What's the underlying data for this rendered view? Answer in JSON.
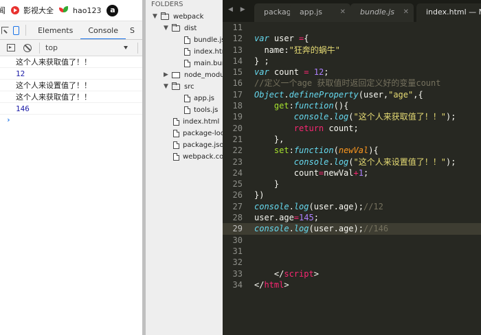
{
  "bookmarks": {
    "items": [
      {
        "label": "闻"
      },
      {
        "label": "影视大全"
      },
      {
        "label": "hao123"
      },
      {
        "label": ""
      }
    ]
  },
  "devtools": {
    "tabs": [
      "Elements",
      "Console",
      "S"
    ],
    "active_tab": "Console",
    "context": "top",
    "console_lines": [
      {
        "text": "这个人来获取值了！！",
        "kind": "txt"
      },
      {
        "text": "12",
        "kind": "num"
      },
      {
        "text": "这个人来设置值了！！",
        "kind": "txt"
      },
      {
        "text": "这个人来获取值了！！",
        "kind": "txt"
      },
      {
        "text": "146",
        "kind": "num"
      }
    ],
    "prompt": "›"
  },
  "sidebar": {
    "header": "FOLDERS",
    "tree": [
      {
        "label": "webpack",
        "type": "folder-open",
        "depth": 0
      },
      {
        "label": "dist",
        "type": "folder-open",
        "depth": 1
      },
      {
        "label": "bundle.js",
        "type": "file",
        "depth": 2
      },
      {
        "label": "index.html",
        "type": "file",
        "depth": 2
      },
      {
        "label": "main.bundle.js",
        "type": "file",
        "depth": 2
      },
      {
        "label": "node_modules",
        "type": "folder-closed",
        "depth": 1
      },
      {
        "label": "src",
        "type": "folder-open",
        "depth": 1
      },
      {
        "label": "app.js",
        "type": "file",
        "depth": 2
      },
      {
        "label": "tools.js",
        "type": "file",
        "depth": 2
      },
      {
        "label": "index.html",
        "type": "file",
        "depth": 1
      },
      {
        "label": "package-lock.json",
        "type": "file",
        "depth": 1
      },
      {
        "label": "package.json",
        "type": "file",
        "depth": 1
      },
      {
        "label": "webpack.config.js",
        "type": "file",
        "depth": 1
      }
    ]
  },
  "editor": {
    "nav": "◀ ▶",
    "tabs": [
      {
        "label": "package.json",
        "active": false,
        "italic": false
      },
      {
        "label": "app.js",
        "active": false,
        "italic": false
      },
      {
        "label": "bundle.js",
        "active": false,
        "italic": true
      },
      {
        "label": "index.html — Mr.M\\webpack",
        "active": true,
        "italic": false
      }
    ],
    "current_line": 29,
    "lines": [
      {
        "n": "11",
        "tokens": []
      },
      {
        "n": "12",
        "tokens": [
          {
            "t": "var",
            "c": "k"
          },
          {
            "t": " user "
          },
          {
            "t": "=",
            "c": "kw"
          },
          {
            "t": "{"
          }
        ]
      },
      {
        "n": "13",
        "tokens": [
          {
            "t": "  name:"
          },
          {
            "t": "\"狂奔的蜗牛\"",
            "c": "s"
          }
        ]
      },
      {
        "n": "14",
        "tokens": [
          {
            "t": "} ;"
          }
        ]
      },
      {
        "n": "15",
        "tokens": [
          {
            "t": "var",
            "c": "k"
          },
          {
            "t": " count "
          },
          {
            "t": "=",
            "c": "kw"
          },
          {
            "t": " "
          },
          {
            "t": "12",
            "c": "n"
          },
          {
            "t": ";"
          }
        ]
      },
      {
        "n": "16",
        "tokens": [
          {
            "t": "//定义一个age 获取值时返回定义好的变量count",
            "c": "c"
          }
        ]
      },
      {
        "n": "17",
        "tokens": [
          {
            "t": "Object",
            "c": "cn"
          },
          {
            "t": "."
          },
          {
            "t": "defineProperty",
            "c": "it"
          },
          {
            "t": "(user,"
          },
          {
            "t": "\"age\"",
            "c": "s"
          },
          {
            "t": ",{"
          }
        ]
      },
      {
        "n": "18",
        "tokens": [
          {
            "t": "    "
          },
          {
            "t": "get",
            "c": "f"
          },
          {
            "t": ":"
          },
          {
            "t": "function",
            "c": "k"
          },
          {
            "t": "(){"
          }
        ]
      },
      {
        "n": "19",
        "tokens": [
          {
            "t": "        "
          },
          {
            "t": "console",
            "c": "cn"
          },
          {
            "t": "."
          },
          {
            "t": "log",
            "c": "it"
          },
          {
            "t": "("
          },
          {
            "t": "\"这个人来获取值了！！\"",
            "c": "s"
          },
          {
            "t": ");"
          }
        ]
      },
      {
        "n": "20",
        "tokens": [
          {
            "t": "        "
          },
          {
            "t": "return",
            "c": "kw"
          },
          {
            "t": " count;"
          }
        ]
      },
      {
        "n": "21",
        "tokens": [
          {
            "t": "    },"
          }
        ]
      },
      {
        "n": "22",
        "tokens": [
          {
            "t": "    "
          },
          {
            "t": "set",
            "c": "f"
          },
          {
            "t": ":"
          },
          {
            "t": "function",
            "c": "k"
          },
          {
            "t": "("
          },
          {
            "t": "newVal",
            "c": "p"
          },
          {
            "t": "){"
          }
        ]
      },
      {
        "n": "23",
        "tokens": [
          {
            "t": "        "
          },
          {
            "t": "console",
            "c": "cn"
          },
          {
            "t": "."
          },
          {
            "t": "log",
            "c": "it"
          },
          {
            "t": "("
          },
          {
            "t": "\"这个人来设置值了！！\"",
            "c": "s"
          },
          {
            "t": ");"
          }
        ]
      },
      {
        "n": "24",
        "tokens": [
          {
            "t": "        count"
          },
          {
            "t": "=",
            "c": "kw"
          },
          {
            "t": "newVal"
          },
          {
            "t": "+",
            "c": "kw"
          },
          {
            "t": "1",
            "c": "n"
          },
          {
            "t": ";"
          }
        ]
      },
      {
        "n": "25",
        "tokens": [
          {
            "t": "    }"
          }
        ]
      },
      {
        "n": "26",
        "tokens": [
          {
            "t": "})"
          }
        ]
      },
      {
        "n": "27",
        "tokens": [
          {
            "t": "console",
            "c": "cn"
          },
          {
            "t": "."
          },
          {
            "t": "log",
            "c": "it"
          },
          {
            "t": "(user.age);"
          },
          {
            "t": "//12",
            "c": "c"
          }
        ]
      },
      {
        "n": "28",
        "tokens": [
          {
            "t": "user.age"
          },
          {
            "t": "=",
            "c": "kw"
          },
          {
            "t": "145",
            "c": "n"
          },
          {
            "t": ";"
          }
        ]
      },
      {
        "n": "29",
        "tokens": [
          {
            "t": "console",
            "c": "cn"
          },
          {
            "t": "."
          },
          {
            "t": "log",
            "c": "it"
          },
          {
            "t": "(user.age);"
          },
          {
            "t": "//146",
            "c": "c"
          }
        ]
      },
      {
        "n": "30",
        "tokens": []
      },
      {
        "n": "31",
        "tokens": []
      },
      {
        "n": "32",
        "tokens": []
      },
      {
        "n": "33",
        "tokens": [
          {
            "t": "    </"
          },
          {
            "t": "script",
            "c": "kw"
          },
          {
            "t": ">"
          }
        ]
      },
      {
        "n": "34",
        "tokens": [
          {
            "t": "</"
          },
          {
            "t": "html",
            "c": "kw"
          },
          {
            "t": ">"
          }
        ]
      }
    ]
  },
  "colors": {
    "editor_bg": "#272822",
    "sidebar_bg": "#eeeeee",
    "devtools_accent": "#1a73e8",
    "console_number": "#1a1aa6"
  }
}
